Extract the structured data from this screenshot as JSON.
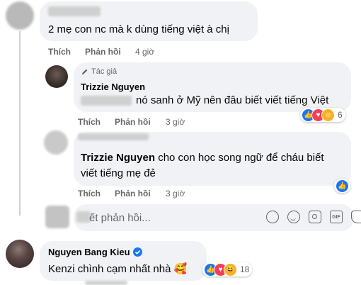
{
  "comment1": {
    "text": "2 mẹ con nc mà k dùng tiếng việt à chị",
    "actions": {
      "like": "Thích",
      "reply": "Phản hồi"
    },
    "time": "4 giờ"
  },
  "reply1": {
    "badge_icon": "pencil-icon",
    "badge": "Tác giả",
    "author": "Trizzie Nguyen",
    "text": "nó sanh ở Mỹ nên đâu biết viết tiếng Việt",
    "actions": {
      "like": "Thích",
      "reply": "Phản hồi"
    },
    "time": "3 giờ",
    "reactions": [
      "like",
      "love",
      "care"
    ],
    "reaction_count": "6"
  },
  "reply2": {
    "mention": "Trizzie Nguyen",
    "text_line1": "cho con học song ngữ để cháu biết",
    "text_line2": "viết tiếng mẹ đẻ",
    "actions": {
      "like": "Thích",
      "reply": "Phản hồi"
    },
    "time": "3 giờ",
    "reactions": [
      "like"
    ]
  },
  "reply_box": {
    "placeholder_tail": "ết phản hồi...",
    "tools": [
      "sticker-icon",
      "emoji-icon",
      "camera-icon",
      "gif-icon",
      "sticker-square-icon"
    ]
  },
  "comment2": {
    "author": "Nguyen Bang Kieu",
    "verified": true,
    "text": "Kenzi chình cạm nhất nhà",
    "emoji": "🥰",
    "reactions": [
      "like",
      "love",
      "haha"
    ],
    "reaction_count": "18"
  },
  "colors": {
    "accent": "#1877f2",
    "bubble": "#f0f2f5",
    "secondary": "#65676b"
  }
}
